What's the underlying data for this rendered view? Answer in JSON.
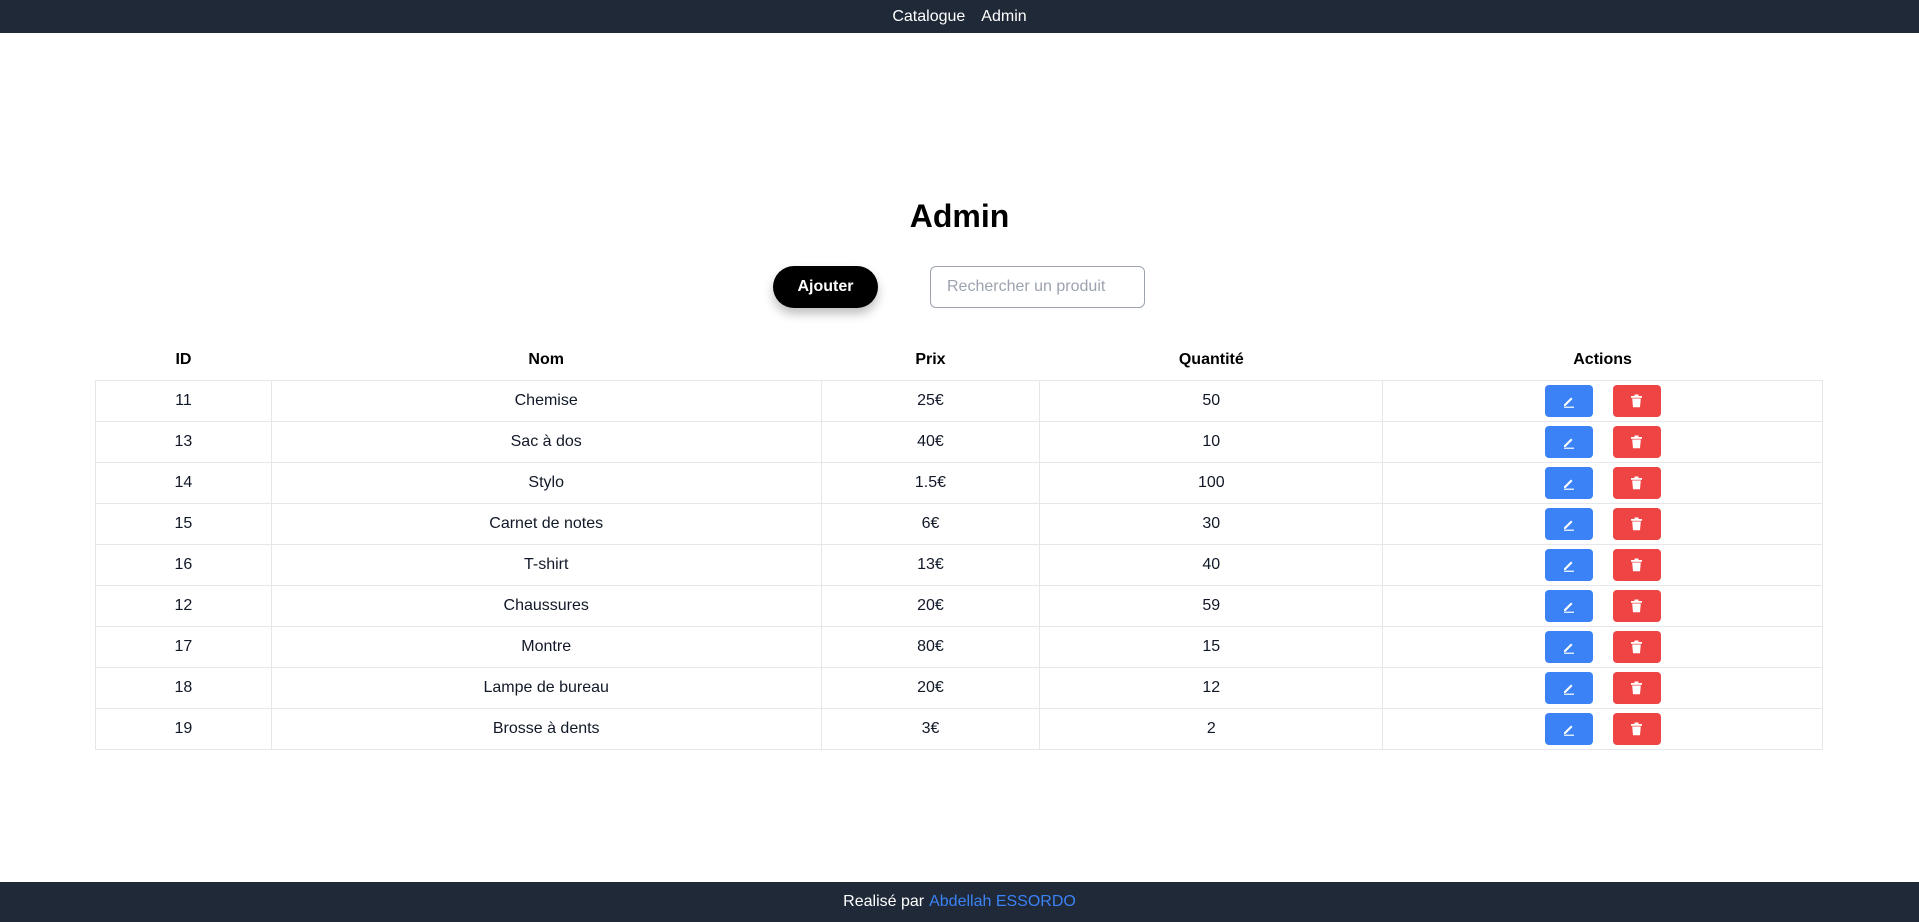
{
  "nav": {
    "links": [
      "Catalogue",
      "Admin"
    ]
  },
  "page": {
    "title": "Admin"
  },
  "toolbar": {
    "add_label": "Ajouter",
    "search_placeholder": "Rechercher un produit",
    "search_value": ""
  },
  "table": {
    "headers": [
      "ID",
      "Nom",
      "Prix",
      "Quantité",
      "Actions"
    ],
    "rows": [
      {
        "id": "11",
        "name": "Chemise",
        "price": "25€",
        "qty": "50"
      },
      {
        "id": "13",
        "name": "Sac à dos",
        "price": "40€",
        "qty": "10"
      },
      {
        "id": "14",
        "name": "Stylo",
        "price": "1.5€",
        "qty": "100"
      },
      {
        "id": "15",
        "name": "Carnet de notes",
        "price": "6€",
        "qty": "30"
      },
      {
        "id": "16",
        "name": "T-shirt",
        "price": "13€",
        "qty": "40"
      },
      {
        "id": "12",
        "name": "Chaussures",
        "price": "20€",
        "qty": "59"
      },
      {
        "id": "17",
        "name": "Montre",
        "price": "80€",
        "qty": "15"
      },
      {
        "id": "18",
        "name": "Lampe de bureau",
        "price": "20€",
        "qty": "12"
      },
      {
        "id": "19",
        "name": "Brosse à dents",
        "price": "3€",
        "qty": "2"
      }
    ],
    "row_actions": {
      "edit_icon": "pencil-icon",
      "delete_icon": "trash-icon"
    }
  },
  "footer": {
    "prefix": "Realisé par",
    "author": "Abdellah ESSORDO"
  },
  "colors": {
    "navbar_bg": "#1f2937",
    "edit_button": "#3b82f6",
    "delete_button": "#ef4444",
    "add_button": "#000000",
    "author_link": "#3b82f6"
  }
}
